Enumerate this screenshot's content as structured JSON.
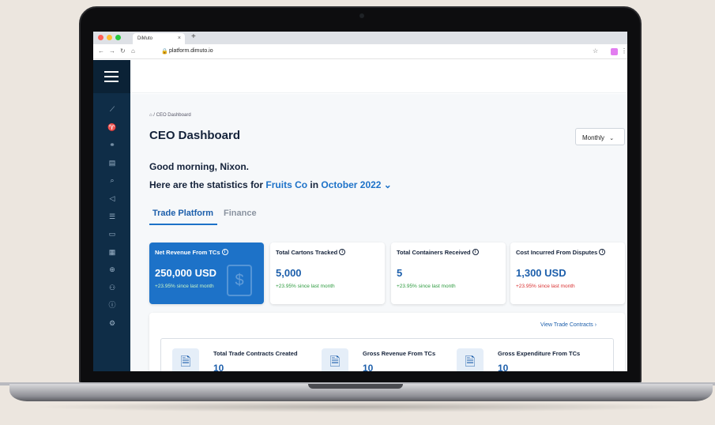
{
  "browser": {
    "tab_title": "DiMuto",
    "tab_close": "×",
    "new_tab": "+",
    "url": "platform.dimuto.io",
    "traffic_colors": [
      "#ff5f57",
      "#febc2e",
      "#28c840"
    ]
  },
  "header": {
    "breadcrumb": "/ CEO Dashboard",
    "title": "CEO Dashboard",
    "period_select": "Monthly"
  },
  "greeting": {
    "line1": "Good morning, Nixon.",
    "line2_prefix": "Here are the statistics for ",
    "company": "Fruits Co",
    "line2_mid": " in ",
    "period": "October 2022"
  },
  "tabs": [
    {
      "label": "Trade Platform",
      "active": true
    },
    {
      "label": "Finance",
      "active": false
    }
  ],
  "cards": [
    {
      "label": "Net Revenue From TCs",
      "value": "250,000 USD",
      "change": "+23.95%",
      "change_text": " since last month",
      "active": true
    },
    {
      "label": "Total Cartons Tracked",
      "value": "5,000",
      "change": "+23.95%",
      "change_text": " since last month",
      "active": false
    },
    {
      "label": "Total Containers Received",
      "value": "5",
      "change": "+23.95%",
      "change_text": " since last month",
      "active": false
    },
    {
      "label": "Cost Incurred From Disputes",
      "value": "1,300 USD",
      "change": "+23.95%",
      "change_text": " since last month",
      "active": false,
      "negative": true
    }
  ],
  "trade_contracts": {
    "link": "View Trade Contracts",
    "items": [
      {
        "label": "Total Trade Contracts Created",
        "value": "10"
      },
      {
        "label": "Gross Revenue From TCs",
        "value": "10"
      },
      {
        "label": "Gross Expenditure From TCs",
        "value": "10"
      }
    ]
  },
  "sidebar_icons": [
    "chart-icon",
    "sprout-icon",
    "handshake-icon",
    "document-icon",
    "search-icon",
    "megaphone-icon",
    "database-icon",
    "wallet-icon",
    "invoice-icon",
    "dollar-icon",
    "users-icon",
    "info-icon",
    "settings-icon"
  ],
  "colors": {
    "primary": "#1d72c8",
    "sidebar": "#0f2d47",
    "positive": "#2d9a3f",
    "negative": "#d93030"
  }
}
